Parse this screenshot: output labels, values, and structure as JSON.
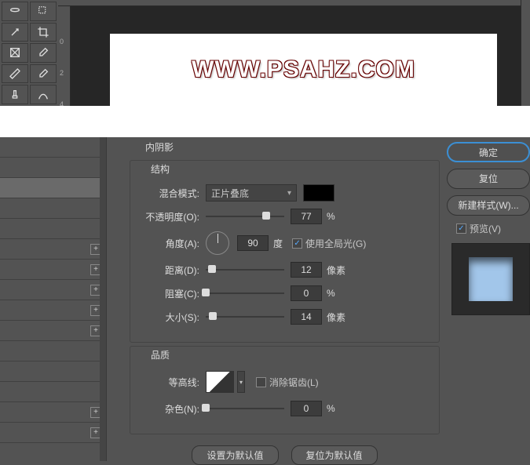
{
  "canvas": {
    "text": "WWW.PSAHZ.COM"
  },
  "ruler": {
    "m0": "0",
    "m2": "2",
    "m4": "4"
  },
  "section": {
    "title": "内阴影",
    "structure": "结构",
    "quality": "品质"
  },
  "blend": {
    "label": "混合模式:",
    "value": "正片叠底"
  },
  "opacity": {
    "label": "不透明度(O):",
    "value": "77",
    "unit": "%"
  },
  "angle": {
    "label": "角度(A):",
    "value": "90",
    "unit": "度",
    "global": "使用全局光(G)"
  },
  "distance": {
    "label": "距离(D):",
    "value": "12",
    "unit": "像素"
  },
  "choke": {
    "label": "阻塞(C):",
    "value": "0",
    "unit": "%"
  },
  "size": {
    "label": "大小(S):",
    "value": "14",
    "unit": "像素"
  },
  "contour": {
    "label": "等高线:",
    "antialias": "消除锯齿(L)"
  },
  "noise": {
    "label": "杂色(N):",
    "value": "0",
    "unit": "%"
  },
  "buttons": {
    "default": "设置为默认值",
    "reset": "复位为默认值"
  },
  "right": {
    "ok": "确定",
    "cancel": "复位",
    "newstyle": "新建样式(W)...",
    "preview": "预览(V)"
  }
}
